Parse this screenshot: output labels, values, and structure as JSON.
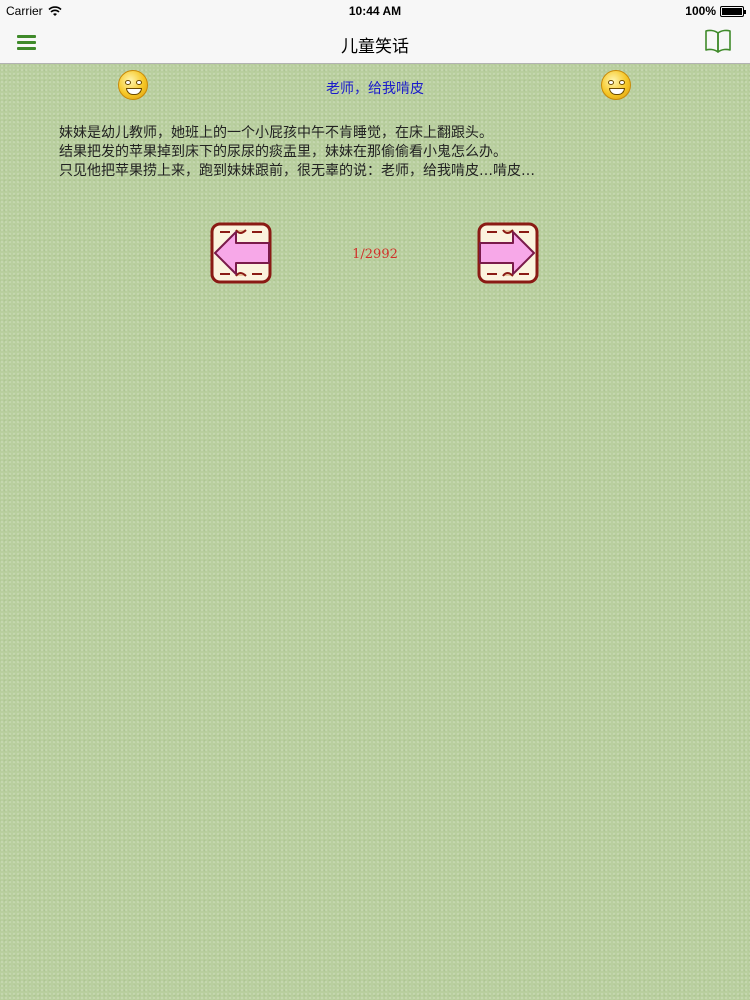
{
  "status_bar": {
    "carrier": "Carrier",
    "time": "10:44 AM",
    "battery": "100%",
    "battery_level": 1.0
  },
  "nav": {
    "title": "儿童笑话",
    "left_icon": "menu-icon",
    "right_icon": "book-icon",
    "accent_color": "#3f8a2a"
  },
  "joke": {
    "title": "老师，给我啃皮",
    "lines": [
      "妹妹是幼儿教师，她班上的一个小屁孩中午不肯睡觉，在床上翻跟头。",
      "结果把发的苹果掉到床下的尿尿的痰盂里，妹妹在那偷偷看小鬼怎么办。",
      "只见他把苹果捞上来，跑到妹妹跟前，很无辜的说：老师，给我啃皮…啃皮…"
    ],
    "title_color": "#1a1acc"
  },
  "pager": {
    "counter": "1/2992",
    "prev_icon": "arrow-left-icon",
    "next_icon": "arrow-right-icon",
    "counter_color": "#d0302a"
  }
}
